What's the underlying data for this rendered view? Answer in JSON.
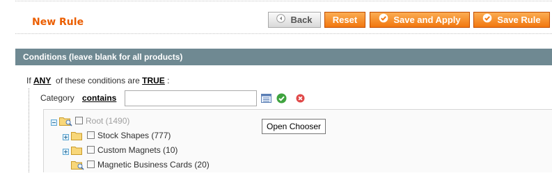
{
  "page": {
    "title": "New Rule"
  },
  "toolbar": {
    "back_label": "Back",
    "reset_label": "Reset",
    "save_apply_label": "Save and Apply",
    "save_rule_label": "Save Rule"
  },
  "section": {
    "heading": "Conditions (leave blank for all products)"
  },
  "conditions": {
    "prefix": "If",
    "aggregator": "ANY",
    "middle": "of these conditions are",
    "value": "TRUE",
    "suffix": ":"
  },
  "condition_row": {
    "attribute": "Category",
    "operator": "contains",
    "value": ""
  },
  "tooltip": {
    "text": "Open Chooser"
  },
  "tree": {
    "items": [
      {
        "label": "Root (1490)",
        "expander": "minus",
        "muted": true
      },
      {
        "label": "Stock Shapes (777)",
        "expander": "plus",
        "muted": false
      },
      {
        "label": "Custom Magnets (10)",
        "expander": "plus",
        "muted": false
      },
      {
        "label": "Magnetic Business Cards (20)",
        "expander": "none",
        "muted": false
      }
    ]
  },
  "colors": {
    "accent": "#eb5e00",
    "button_orange": "#f48c25",
    "section_header": "#6f8992",
    "apply_green": "#3fa33f",
    "remove_red": "#e04848"
  }
}
